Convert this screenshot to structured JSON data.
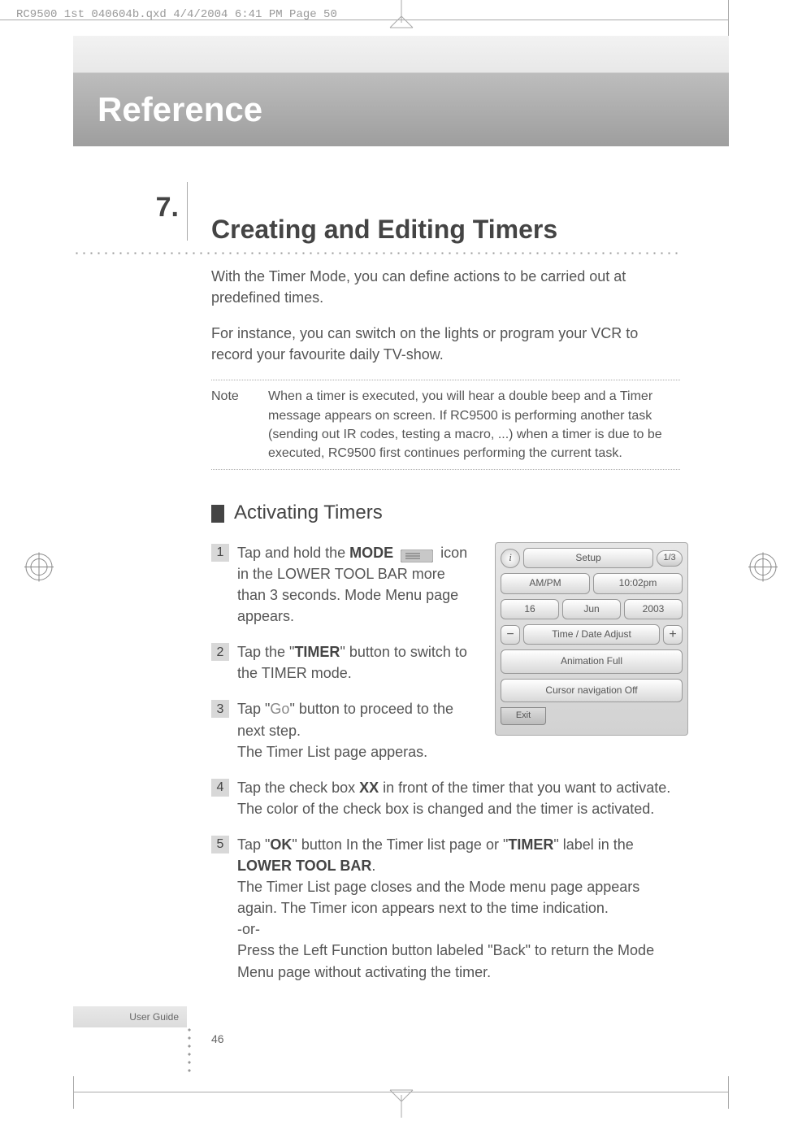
{
  "print_meta": "RC9500 1st 040604b.qxd  4/4/2004  6:41 PM  Page 50",
  "chapter_title": "Reference",
  "section": {
    "number": "7.",
    "title": "Creating and Editing Timers"
  },
  "intro": {
    "p1": "With the Timer Mode, you can define actions to be carried out at predefined times.",
    "p2": "For instance, you can switch on the lights or program your VCR to record your favourite daily TV-show."
  },
  "note": {
    "label": "Note",
    "text": "When a timer is executed, you will hear a double beep and a Timer message appears on screen. If RC9500 is performing another task (sending out IR codes, testing a macro, ...) when a timer is due to be executed, RC9500 first continues performing the current task."
  },
  "subheading": "Activating Timers",
  "steps": {
    "s1_a": "Tap and hold the ",
    "s1_mode": "MODE",
    "s1_b": " icon in the LOWER TOOL BAR more than 3 seconds. Mode Menu page appears.",
    "s2_a": "Tap the \"",
    "s2_timer": "TIMER",
    "s2_b": "\" button to switch to the TIMER mode.",
    "s3_a": "Tap \"",
    "s3_go": "Go",
    "s3_b": "\" button to proceed to the next step.",
    "s3_c": "The Timer List page apperas.",
    "s4_a": "Tap the check box ",
    "s4_xx": "XX",
    "s4_b": " in front of the timer that you want to activate.",
    "s4_c": "The color of the check box is changed and the timer is activated.",
    "s5_a": "Tap \"",
    "s5_ok": "OK",
    "s5_b": "\" button In the Timer list page or \"",
    "s5_timer": "TIMER",
    "s5_c": "\" label in the ",
    "s5_ltb": "LOWER TOOL BAR",
    "s5_d": ".",
    "s5_e": "The Timer List page closes and the Mode menu page appears again. The Timer icon appears next to the time indication.",
    "s5_or": "  -or-",
    "s5_f": "Press the Left Function button labeled \"Back\" to return the Mode Menu page without activating the timer."
  },
  "screenshot": {
    "info": "i",
    "title": "Setup",
    "pager": "1/3",
    "ampm": "AM/PM",
    "time": "10:02pm",
    "day": "16",
    "month": "Jun",
    "year": "2003",
    "minus": "−",
    "adjust": "Time / Date Adjust",
    "plus": "+",
    "animation": "Animation Full",
    "cursor": "Cursor navigation Off",
    "exit": "Exit"
  },
  "footer_label": "User Guide",
  "page_number": "46"
}
